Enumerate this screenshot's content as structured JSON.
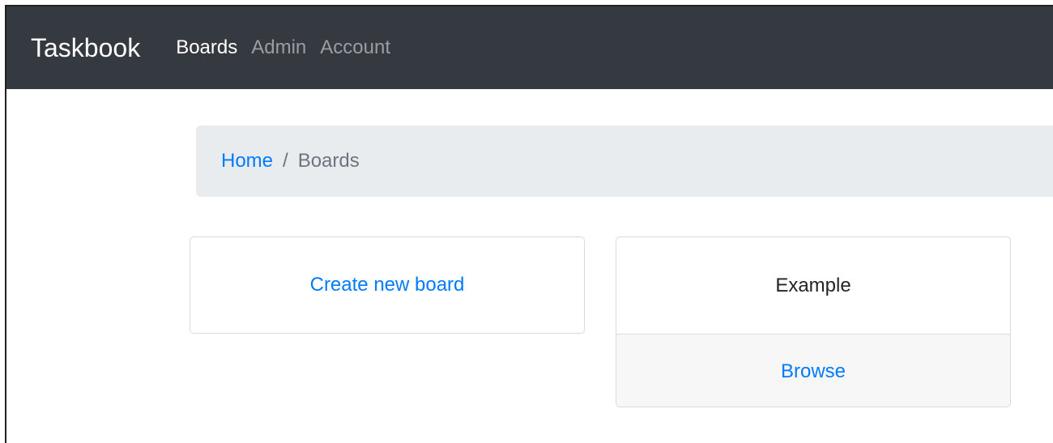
{
  "navbar": {
    "brand": "Taskbook",
    "links": [
      {
        "label": "Boards",
        "active": true
      },
      {
        "label": "Admin",
        "active": false
      },
      {
        "label": "Account",
        "active": false
      }
    ]
  },
  "breadcrumb": {
    "home": "Home",
    "separator": "/",
    "current": "Boards"
  },
  "cards": {
    "create": {
      "link": "Create new board"
    },
    "boards": [
      {
        "title": "Example",
        "action": "Browse"
      }
    ]
  },
  "colors": {
    "navbar_bg": "#343a40",
    "link": "#007bff",
    "breadcrumb_bg": "#e9ecef"
  }
}
